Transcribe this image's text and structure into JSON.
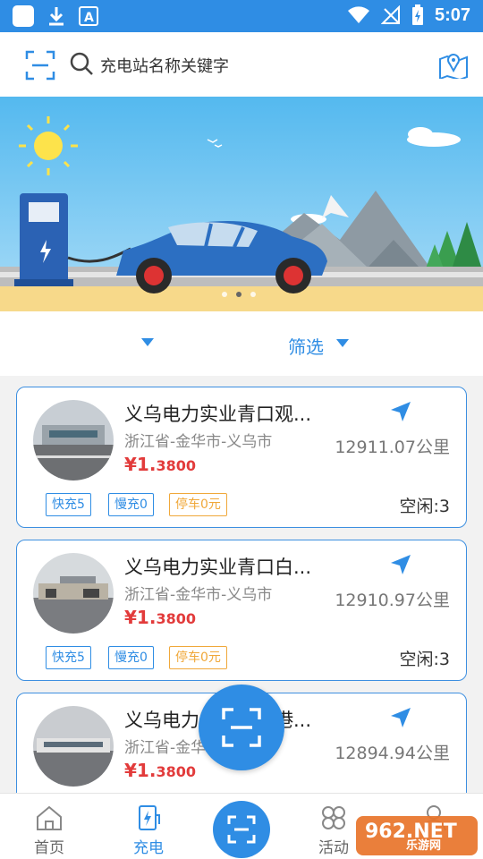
{
  "status_bar": {
    "time": "5:07"
  },
  "search": {
    "placeholder": "充电站名称关键字"
  },
  "filter": {
    "label": "筛选"
  },
  "stations": [
    {
      "name": "义乌电力实业青口观...",
      "address": "浙江省-金华市-义乌市",
      "price_int": "¥1.",
      "price_dec": "3800",
      "distance": "12911.07公里",
      "tags": [
        "快充5",
        "慢充0",
        "停车0元"
      ],
      "idle": "空闲:3"
    },
    {
      "name": "义乌电力实业青口白...",
      "address": "浙江省-金华市-义乌市",
      "price_int": "¥1.",
      "price_dec": "3800",
      "distance": "12910.97公里",
      "tags": [
        "快充5",
        "慢充0",
        "停车0元"
      ],
      "idle": "空闲:3"
    },
    {
      "name": "义乌电力实业青口港...",
      "address": "浙江省-金华市-义乌市",
      "price_int": "¥1.",
      "price_dec": "3800",
      "distance": "12894.94公里"
    }
  ],
  "bottom_nav": {
    "home": "首页",
    "charge": "充电",
    "activity": "活动"
  },
  "watermark": {
    "text": "乐游网",
    "logo": "962.NET"
  },
  "colors": {
    "primary": "#2f8de4",
    "price": "#e23b3b",
    "parking_tag": "#f0a83a"
  }
}
